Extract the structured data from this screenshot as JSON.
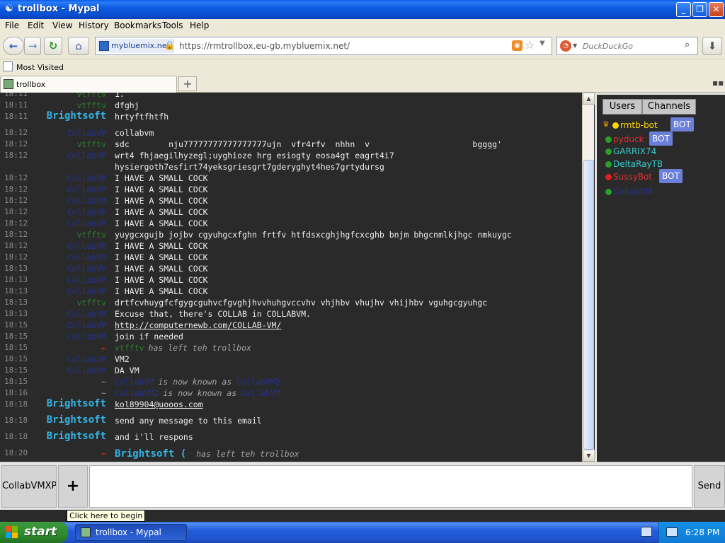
{
  "window": {
    "title": "trollbox - Mypal"
  },
  "menu": [
    "File",
    "Edit",
    "View",
    "History",
    "Bookmarks",
    "Tools",
    "Help"
  ],
  "nav": {
    "site_identity": "mybluemix.net",
    "url": "https://rmtrollbox.eu-gb.mybluemix.net/",
    "search_placeholder": "DuckDuckGo"
  },
  "bookmarks": {
    "most_visited": "Most Visited"
  },
  "tab": {
    "label": "trollbox",
    "new_tab": "+"
  },
  "chat": [
    {
      "time": "18:11",
      "nick": "vtfftv",
      "nick_style": "bot",
      "text": "1."
    },
    {
      "time": "18:11",
      "nick": "vtfftv",
      "nick_style": "bot",
      "text": "dfghj"
    },
    {
      "time": "18:11",
      "nick": "Brightsoft",
      "nick_style": "bright",
      "text": "hrtyftfhtfh"
    },
    {
      "time": "18:12",
      "nick": "CollabVM",
      "nick_style": "blue",
      "text": "collabvm"
    },
    {
      "time": "18:12",
      "nick": "vtfftv",
      "nick_style": "bot",
      "text": "sdc        nju77777777777777777ujn  vfr4rfv  nhhn  v                     bgggg'"
    },
    {
      "time": "18:12",
      "nick": "CollabVM",
      "nick_style": "blue",
      "text": "wrt4 fhjaegilhyzegl;uyghioze hrg esiogty eosa4gt eagrt4i7"
    },
    {
      "time": "",
      "nick": "",
      "nick_style": "blue",
      "text": "hysiergoth7esfirt74yeksgriesgrt7gderyghyt4hes7grtydursg"
    },
    {
      "time": "18:12",
      "nick": "CollabVM",
      "nick_style": "blue",
      "text": "I HAVE A SMALL COCK"
    },
    {
      "time": "18:12",
      "nick": "CollabVM",
      "nick_style": "blue",
      "text": "I HAVE A SMALL COCK"
    },
    {
      "time": "18:12",
      "nick": "CollabVM",
      "nick_style": "blue",
      "text": "I HAVE A SMALL COCK"
    },
    {
      "time": "18:12",
      "nick": "CollabVM",
      "nick_style": "blue",
      "text": "I HAVE A SMALL COCK"
    },
    {
      "time": "18:12",
      "nick": "CollabVM",
      "nick_style": "blue",
      "text": "I HAVE A SMALL COCK"
    },
    {
      "time": "18:12",
      "nick": "vtfftv",
      "nick_style": "bot",
      "text": "yuygcxgujb jojbv cgyuhgcxfghn frtfv htfdsxcghjhgfcxcghb bnjm bhgcnmlkjhgc nmkuygc"
    },
    {
      "time": "18:12",
      "nick": "CollabVM",
      "nick_style": "blue",
      "text": "I HAVE A SMALL COCK"
    },
    {
      "time": "18:12",
      "nick": "CollabVM",
      "nick_style": "blue",
      "text": "I HAVE A SMALL COCK"
    },
    {
      "time": "18:13",
      "nick": "CollabVM",
      "nick_style": "blue",
      "text": "I HAVE A SMALL COCK"
    },
    {
      "time": "18:13",
      "nick": "CollabVM",
      "nick_style": "blue",
      "text": "I HAVE A SMALL COCK"
    },
    {
      "time": "18:13",
      "nick": "CollabVM",
      "nick_style": "blue",
      "text": "I HAVE A SMALL COCK"
    },
    {
      "time": "18:13",
      "nick": "vtfftv",
      "nick_style": "bot",
      "text": "drtfcvhuygfcfgygcguhvcfgvghjhvvhuhgvccvhv vhjhbv vhujhv vhijhbv vguhgcgyuhgc"
    },
    {
      "time": "18:13",
      "nick": "CollabVM",
      "nick_style": "blue",
      "text": "Excuse that, there's COLLAB in COLLABVM."
    },
    {
      "time": "18:15",
      "nick": "CollabVM",
      "nick_style": "blue",
      "text": "http://computernewb.com/COLLAB-VM/",
      "link": true
    },
    {
      "time": "18:15",
      "nick": "CollabVM",
      "nick_style": "blue",
      "text": "join if needed"
    },
    {
      "time": "18:15",
      "nick": "←",
      "nick_style": "arrow-r",
      "sys_nick": "vtfftv",
      "text": "has left teh trollbox",
      "system": true
    },
    {
      "time": "18:15",
      "nick": "CollabVM",
      "nick_style": "blue",
      "text": "VM2"
    },
    {
      "time": "18:15",
      "nick": "CollabVM",
      "nick_style": "blue",
      "text": "DA VM"
    },
    {
      "time": "18:15",
      "nick": "~",
      "nick_style": "arrow-g",
      "sys_nick": "CollabVM",
      "text": "is now known as",
      "system": true,
      "after": "CollabVM2"
    },
    {
      "time": "18:16",
      "nick": "~",
      "nick_style": "arrow-g",
      "sys_nick": "CollabVM2",
      "text": "is now known as",
      "system": true,
      "after": "CollabVM"
    },
    {
      "time": "18:18",
      "nick": "Brightsoft",
      "nick_style": "bright",
      "text": "kol89904@uooos.com",
      "link": true
    },
    {
      "time": "18:18",
      "nick": "Brightsoft",
      "nick_style": "bright",
      "text": "send any message to this email"
    },
    {
      "time": "18:18",
      "nick": "Brightsoft",
      "nick_style": "bright",
      "text": "and i'll respons"
    },
    {
      "time": "18:20",
      "nick": "←",
      "nick_style": "arrow-r",
      "sys_nick": "Brightsoft (",
      "text": "has left teh trollbox",
      "system": true,
      "bright": true
    }
  ],
  "users_panel": {
    "tab_users": "Users",
    "tab_channels": "Channels",
    "users": [
      {
        "name": "rmtb-bot",
        "color": "#ffd800",
        "dot": "#ffd800",
        "bot": true,
        "crown": true
      },
      {
        "name": "pyduck",
        "color": "#e03030",
        "dot": "#2aa02a",
        "bot": true
      },
      {
        "name": "GARRIX74",
        "color": "#38c8c8",
        "dot": "#2aa02a",
        "bot": false
      },
      {
        "name": "DeltaRayTB",
        "color": "#38c8c8",
        "dot": "#2aa02a",
        "bot": false
      },
      {
        "name": "SussyBot",
        "color": "#e03030",
        "dot": "#e02020",
        "bot": true
      },
      {
        "name": "CollabVM",
        "color": "#27308e",
        "dot": "#2aa02a",
        "bot": false
      }
    ],
    "bot_label": "BOT"
  },
  "input_bar": {
    "channel": "CollabVMXP",
    "add": "+",
    "send": "Send",
    "tooltip": "Click here to begin"
  },
  "taskbar": {
    "start": "start",
    "task": "trollbox - Mypal",
    "clock": "6:28 PM"
  }
}
